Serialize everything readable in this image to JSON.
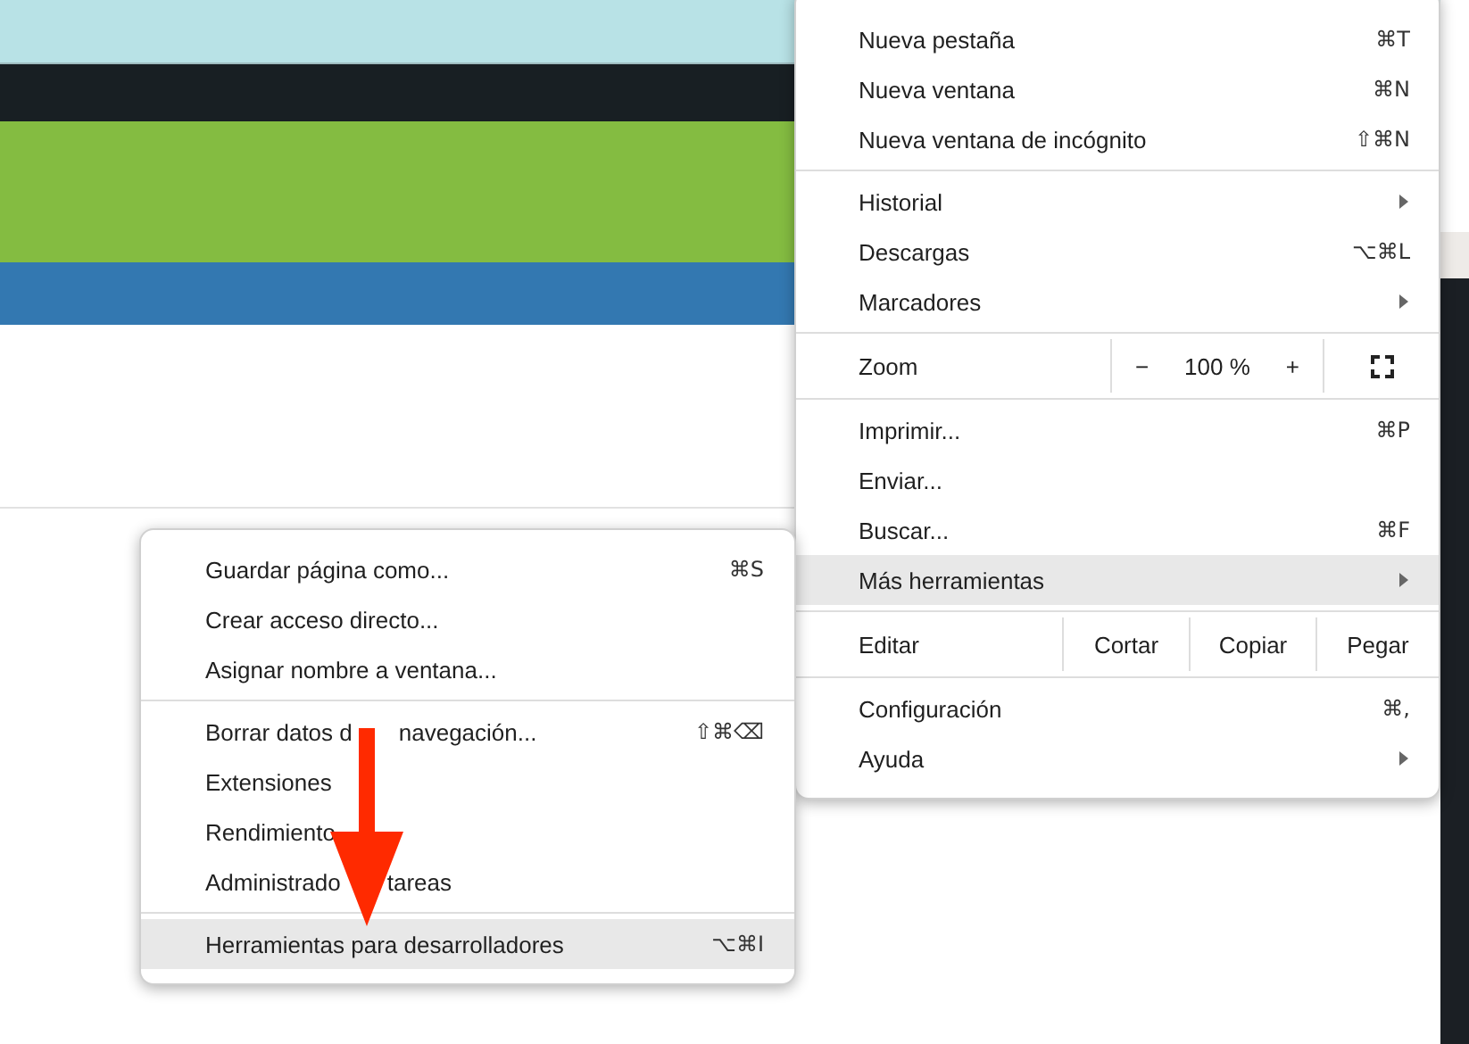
{
  "main_menu": {
    "items": [
      {
        "kind": "item",
        "label": "Nueva pestaña",
        "shortcut": "⌘T",
        "submenu": false,
        "selected": false
      },
      {
        "kind": "item",
        "label": "Nueva ventana",
        "shortcut": "⌘N",
        "submenu": false,
        "selected": false
      },
      {
        "kind": "item",
        "label": "Nueva ventana de incógnito",
        "shortcut": "⇧⌘N",
        "submenu": false,
        "selected": false
      },
      {
        "kind": "separator"
      },
      {
        "kind": "item",
        "label": "Historial",
        "submenu": true,
        "selected": false
      },
      {
        "kind": "item",
        "label": "Descargas",
        "shortcut": "⌥⌘L",
        "submenu": false,
        "selected": false
      },
      {
        "kind": "item",
        "label": "Marcadores",
        "submenu": true,
        "selected": false
      },
      {
        "kind": "separator"
      },
      {
        "kind": "zoom",
        "label": "Zoom",
        "minus": "−",
        "value": "100 %",
        "plus": "+"
      },
      {
        "kind": "separator"
      },
      {
        "kind": "item",
        "label": "Imprimir...",
        "shortcut": "⌘P",
        "submenu": false,
        "selected": false
      },
      {
        "kind": "item",
        "label": "Enviar...",
        "submenu": false,
        "selected": false
      },
      {
        "kind": "item",
        "label": "Buscar...",
        "shortcut": "⌘F",
        "submenu": false,
        "selected": false
      },
      {
        "kind": "item",
        "label": "Más herramientas",
        "submenu": true,
        "selected": true
      },
      {
        "kind": "separator"
      },
      {
        "kind": "edit",
        "label": "Editar",
        "buttons": [
          "Cortar",
          "Copiar",
          "Pegar"
        ]
      },
      {
        "kind": "separator"
      },
      {
        "kind": "item",
        "label": "Configuración",
        "shortcut": "⌘,",
        "submenu": false,
        "selected": false
      },
      {
        "kind": "item",
        "label": "Ayuda",
        "submenu": true,
        "selected": false
      }
    ]
  },
  "submenu": {
    "items": [
      {
        "kind": "item",
        "label": "Guardar página como...",
        "shortcut": "⌘S",
        "selected": false
      },
      {
        "kind": "item",
        "label": "Crear acceso directo...",
        "selected": false
      },
      {
        "kind": "item",
        "label": "Asignar nombre a ventana...",
        "selected": false
      },
      {
        "kind": "separator"
      },
      {
        "kind": "item",
        "label_parts": [
          "Borrar datos d",
          "navegación..."
        ],
        "shortcut": "⇧⌘⌫",
        "selected": false
      },
      {
        "kind": "item",
        "label": "Extensiones",
        "selected": false
      },
      {
        "kind": "item",
        "label": "Rendimiento",
        "selected": false
      },
      {
        "kind": "item",
        "label_parts": [
          "Administrado",
          "tareas"
        ],
        "selected": false
      },
      {
        "kind": "separator"
      },
      {
        "kind": "item",
        "label": "Herramientas para desarrolladores",
        "shortcut": "⌥⌘I",
        "selected": true
      }
    ]
  }
}
